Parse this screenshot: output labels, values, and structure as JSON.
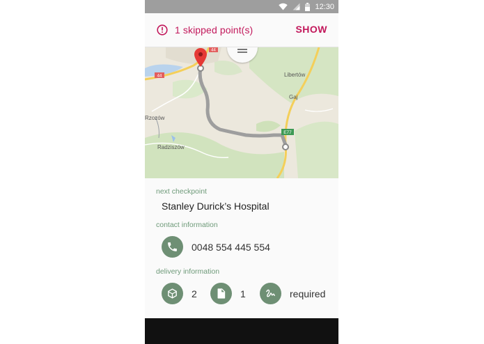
{
  "status_bar": {
    "time": "12:30"
  },
  "banner": {
    "message": "1 skipped point(s)",
    "action": "SHOW",
    "color": "#c2185b"
  },
  "map": {
    "place_labels": [
      "Libertów",
      "Gaj",
      "Rzozów",
      "Radziszów"
    ],
    "road_badges": [
      "44",
      "44",
      "E77"
    ]
  },
  "details": {
    "next_checkpoint_label": "next checkpoint",
    "checkpoint_name": "Stanley Durick’s Hospital",
    "contact_label": "contact information",
    "phone": "0048 554 445 554",
    "delivery_label": "delivery information",
    "packages": "2",
    "documents": "1",
    "signature": "required"
  },
  "icons": {
    "status": [
      "wifi-icon",
      "signal-icon",
      "battery-icon"
    ],
    "alert": "alert-circle-icon",
    "phone": "phone-icon",
    "package": "package-icon",
    "document": "document-icon",
    "signature": "signature-icon"
  },
  "colors": {
    "accent": "#c2185b",
    "label_green": "#6e9a79",
    "icon_circle": "#6e8f74"
  }
}
